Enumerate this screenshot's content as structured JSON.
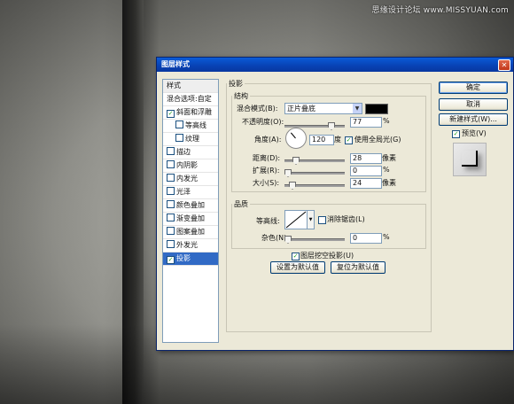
{
  "watermark": "思缘设计论坛 www.MISSYUAN.com",
  "dialog": {
    "title": "图层样式",
    "close_label": "✕"
  },
  "style_list": {
    "header": "样式",
    "items": [
      {
        "label": "混合选项:自定",
        "checkbox": false,
        "checked": false,
        "indent": false,
        "selected": false
      },
      {
        "label": "斜面和浮雕",
        "checkbox": true,
        "checked": true,
        "indent": false,
        "selected": false
      },
      {
        "label": "等高线",
        "checkbox": true,
        "checked": false,
        "indent": true,
        "selected": false
      },
      {
        "label": "纹理",
        "checkbox": true,
        "checked": false,
        "indent": true,
        "selected": false
      },
      {
        "label": "描边",
        "checkbox": true,
        "checked": false,
        "indent": false,
        "selected": false
      },
      {
        "label": "内阴影",
        "checkbox": true,
        "checked": false,
        "indent": false,
        "selected": false
      },
      {
        "label": "内发光",
        "checkbox": true,
        "checked": false,
        "indent": false,
        "selected": false
      },
      {
        "label": "光泽",
        "checkbox": true,
        "checked": false,
        "indent": false,
        "selected": false
      },
      {
        "label": "颜色叠加",
        "checkbox": true,
        "checked": false,
        "indent": false,
        "selected": false
      },
      {
        "label": "渐变叠加",
        "checkbox": true,
        "checked": false,
        "indent": false,
        "selected": false
      },
      {
        "label": "图案叠加",
        "checkbox": true,
        "checked": false,
        "indent": false,
        "selected": false
      },
      {
        "label": "外发光",
        "checkbox": true,
        "checked": false,
        "indent": false,
        "selected": false
      },
      {
        "label": "投影",
        "checkbox": true,
        "checked": true,
        "indent": false,
        "selected": true
      }
    ]
  },
  "drop_shadow": {
    "section_title": "投影",
    "structure": {
      "title": "结构",
      "blend_mode_label": "混合模式(B):",
      "blend_mode_value": "正片叠底",
      "blend_color": "#000000",
      "opacity_label": "不透明度(O):",
      "opacity_value": "77",
      "opacity_unit": "%",
      "angle_label": "角度(A):",
      "angle_value": "120",
      "angle_unit": "度",
      "global_light_label": "使用全局光(G)",
      "global_light_checked": true,
      "distance_label": "距离(D):",
      "distance_value": "28",
      "distance_unit": "像素",
      "spread_label": "扩展(R):",
      "spread_value": "0",
      "spread_unit": "%",
      "size_label": "大小(S):",
      "size_value": "24",
      "size_unit": "像素"
    },
    "quality": {
      "title": "品质",
      "contour_label": "等高线:",
      "anti_alias_label": "消除锯齿(L)",
      "anti_alias_checked": false,
      "noise_label": "杂色(N):",
      "noise_value": "0",
      "noise_unit": "%"
    },
    "knockout_label": "图层挖空投影(U)",
    "knockout_checked": true,
    "make_default_label": "设置为默认值",
    "reset_default_label": "复位为默认值"
  },
  "buttons": {
    "ok": "确定",
    "cancel": "取消",
    "new_style": "新建样式(W)...",
    "preview_label": "预览(V)",
    "preview_checked": true
  },
  "icons": {
    "check": "✓",
    "dropdown": "▼"
  }
}
